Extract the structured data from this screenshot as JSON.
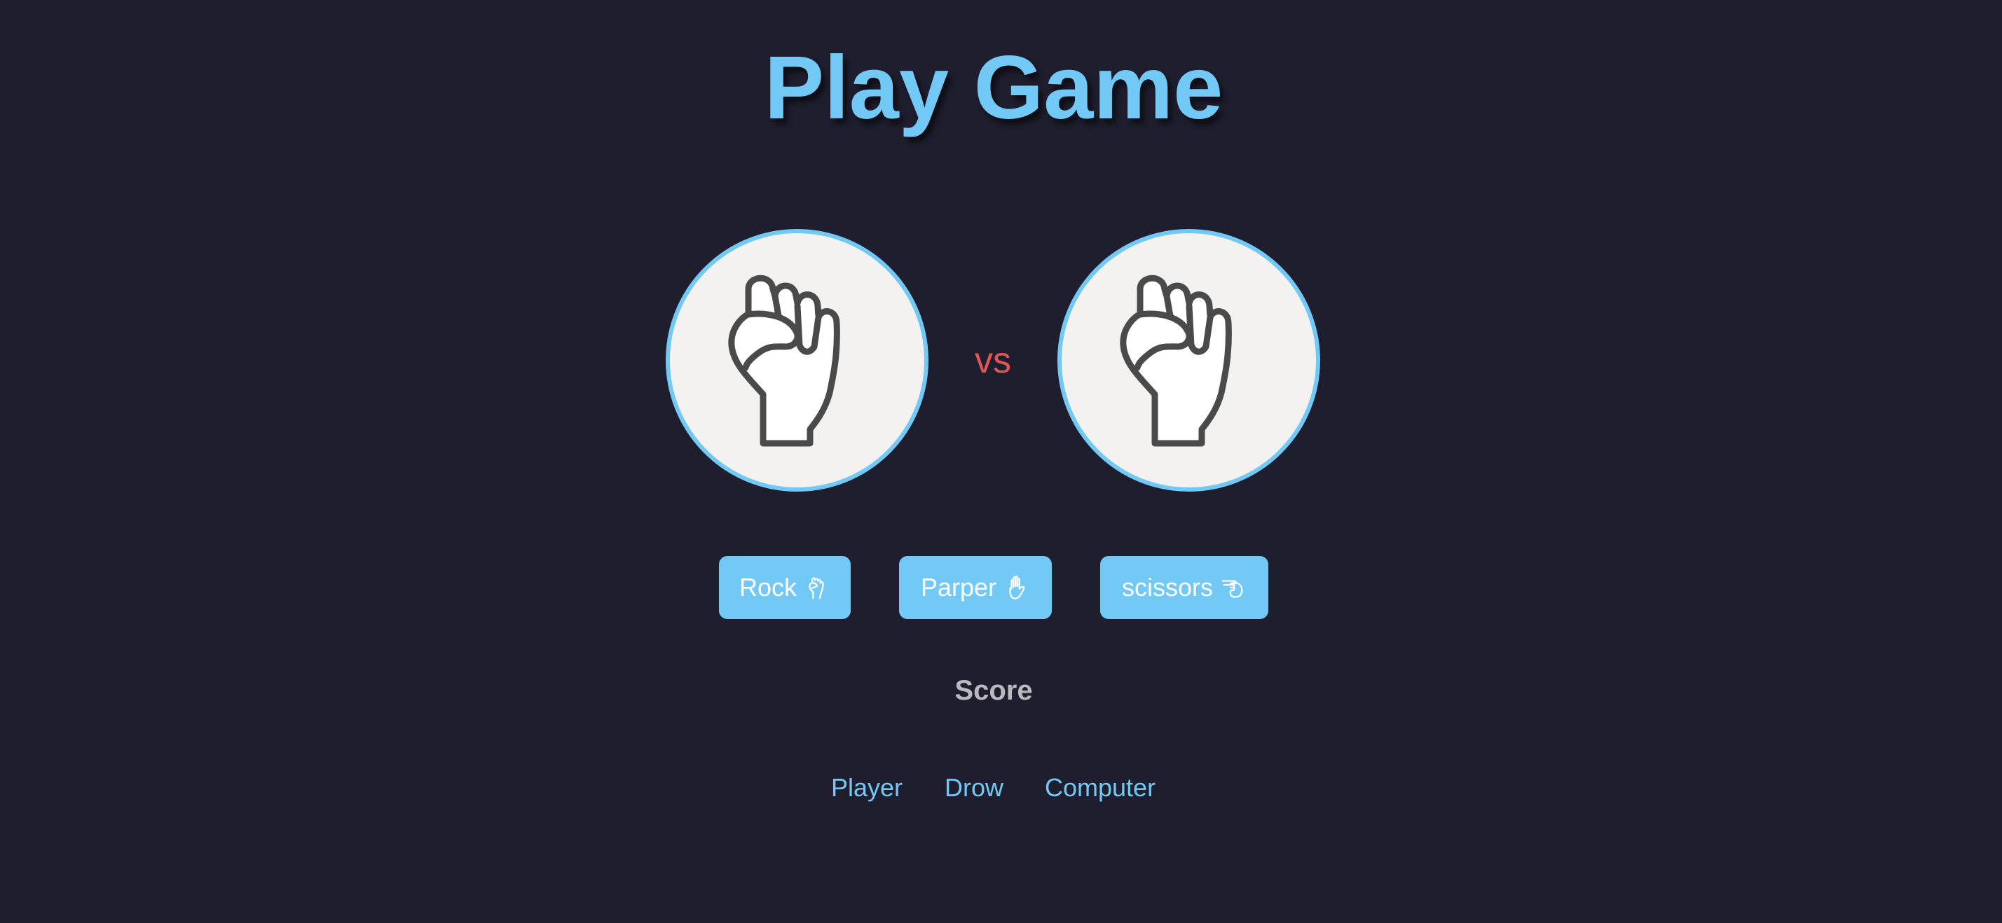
{
  "title": "Play Game",
  "arena": {
    "player_hand": "fist-icon",
    "computer_hand": "fist-icon",
    "vs_label": "vs"
  },
  "choices": [
    {
      "label": "Rock",
      "icon": "fist-icon"
    },
    {
      "label": "Parper",
      "icon": "raised-hand-icon"
    },
    {
      "label": "scissors",
      "icon": "pointing-hand-icon"
    }
  ],
  "score": {
    "title": "Score",
    "labels": {
      "player": "Player",
      "draw": "Drow",
      "computer": "Computer"
    }
  },
  "colors": {
    "background": "#1f1e2e",
    "accent": "#72c9f6",
    "vs": "#e05555",
    "score_title": "#b9b9bf"
  }
}
